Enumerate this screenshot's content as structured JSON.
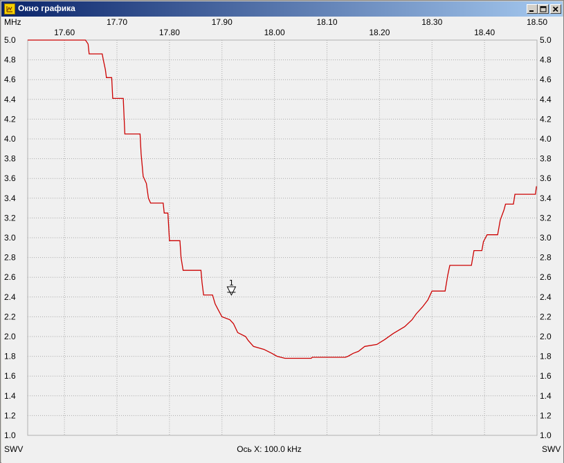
{
  "window": {
    "title": "Окно графика",
    "controls": {
      "minimize": "minimize-icon",
      "maximize": "maximize-icon",
      "close": "close-icon"
    }
  },
  "labels": {
    "x_unit": "MHz",
    "y_left": "SWV",
    "y_right": "SWV",
    "x_axis_caption": "Ось X: 100.0 kHz"
  },
  "chart_data": {
    "type": "line",
    "xlim": [
      17.53,
      18.5
    ],
    "ylim": [
      1.0,
      5.0
    ],
    "x_ticks_row1": [
      "17.70",
      "17.90",
      "18.10",
      "18.30",
      "18.50"
    ],
    "x_ticks_row2": [
      "17.60",
      "17.80",
      "18.00",
      "18.20",
      "18.40"
    ],
    "x_ticks_row1_values": [
      17.7,
      17.9,
      18.1,
      18.3,
      18.5
    ],
    "x_ticks_row2_values": [
      17.6,
      17.8,
      18.0,
      18.2,
      18.4
    ],
    "y_ticks": [
      "5.0",
      "4.8",
      "4.6",
      "4.4",
      "4.2",
      "4.0",
      "3.8",
      "3.6",
      "3.4",
      "3.2",
      "3.0",
      "2.8",
      "2.6",
      "2.4",
      "2.2",
      "2.0",
      "1.8",
      "1.6",
      "1.4",
      "1.2",
      "1.0"
    ],
    "y_tick_values": [
      5.0,
      4.8,
      4.6,
      4.4,
      4.2,
      4.0,
      3.8,
      3.6,
      3.4,
      3.2,
      3.0,
      2.8,
      2.6,
      2.4,
      2.2,
      2.0,
      1.8,
      1.6,
      1.4,
      1.2,
      1.0
    ],
    "grid": true,
    "color": "#cc0000",
    "marker": {
      "label": "1",
      "x": 17.918,
      "y": 2.42
    },
    "series": [
      {
        "points": [
          [
            17.53,
            5.0
          ],
          [
            17.6,
            5.0
          ],
          [
            17.64,
            5.0
          ],
          [
            17.645,
            4.96
          ],
          [
            17.647,
            4.86
          ],
          [
            17.672,
            4.86
          ],
          [
            17.674,
            4.8
          ],
          [
            17.678,
            4.7
          ],
          [
            17.68,
            4.62
          ],
          [
            17.69,
            4.62
          ],
          [
            17.692,
            4.41
          ],
          [
            17.712,
            4.41
          ],
          [
            17.715,
            4.05
          ],
          [
            17.744,
            4.05
          ],
          [
            17.746,
            3.85
          ],
          [
            17.75,
            3.62
          ],
          [
            17.756,
            3.55
          ],
          [
            17.76,
            3.4
          ],
          [
            17.764,
            3.35
          ],
          [
            17.788,
            3.35
          ],
          [
            17.79,
            3.25
          ],
          [
            17.797,
            3.25
          ],
          [
            17.8,
            2.97
          ],
          [
            17.82,
            2.97
          ],
          [
            17.822,
            2.8
          ],
          [
            17.826,
            2.67
          ],
          [
            17.86,
            2.67
          ],
          [
            17.862,
            2.55
          ],
          [
            17.865,
            2.42
          ],
          [
            17.882,
            2.42
          ],
          [
            17.887,
            2.33
          ],
          [
            17.893,
            2.27
          ],
          [
            17.9,
            2.2
          ],
          [
            17.915,
            2.17
          ],
          [
            17.922,
            2.13
          ],
          [
            17.93,
            2.04
          ],
          [
            17.945,
            2.0
          ],
          [
            17.95,
            1.96
          ],
          [
            17.96,
            1.9
          ],
          [
            17.98,
            1.87
          ],
          [
            17.995,
            1.83
          ],
          [
            18.005,
            1.8
          ],
          [
            18.02,
            1.78
          ],
          [
            18.07,
            1.78
          ],
          [
            18.072,
            1.79
          ],
          [
            18.135,
            1.79
          ],
          [
            18.14,
            1.8
          ],
          [
            18.15,
            1.83
          ],
          [
            18.16,
            1.85
          ],
          [
            18.172,
            1.9
          ],
          [
            18.195,
            1.92
          ],
          [
            18.21,
            1.97
          ],
          [
            18.226,
            2.03
          ],
          [
            18.248,
            2.1
          ],
          [
            18.262,
            2.17
          ],
          [
            18.27,
            2.23
          ],
          [
            18.282,
            2.3
          ],
          [
            18.292,
            2.37
          ],
          [
            18.3,
            2.46
          ],
          [
            18.325,
            2.46
          ],
          [
            18.33,
            2.62
          ],
          [
            18.334,
            2.72
          ],
          [
            18.375,
            2.72
          ],
          [
            18.38,
            2.87
          ],
          [
            18.395,
            2.87
          ],
          [
            18.398,
            2.96
          ],
          [
            18.405,
            3.03
          ],
          [
            18.425,
            3.03
          ],
          [
            18.43,
            3.18
          ],
          [
            18.437,
            3.28
          ],
          [
            18.44,
            3.34
          ],
          [
            18.455,
            3.34
          ],
          [
            18.458,
            3.44
          ],
          [
            18.497,
            3.44
          ],
          [
            18.499,
            3.52
          ]
        ]
      }
    ]
  }
}
